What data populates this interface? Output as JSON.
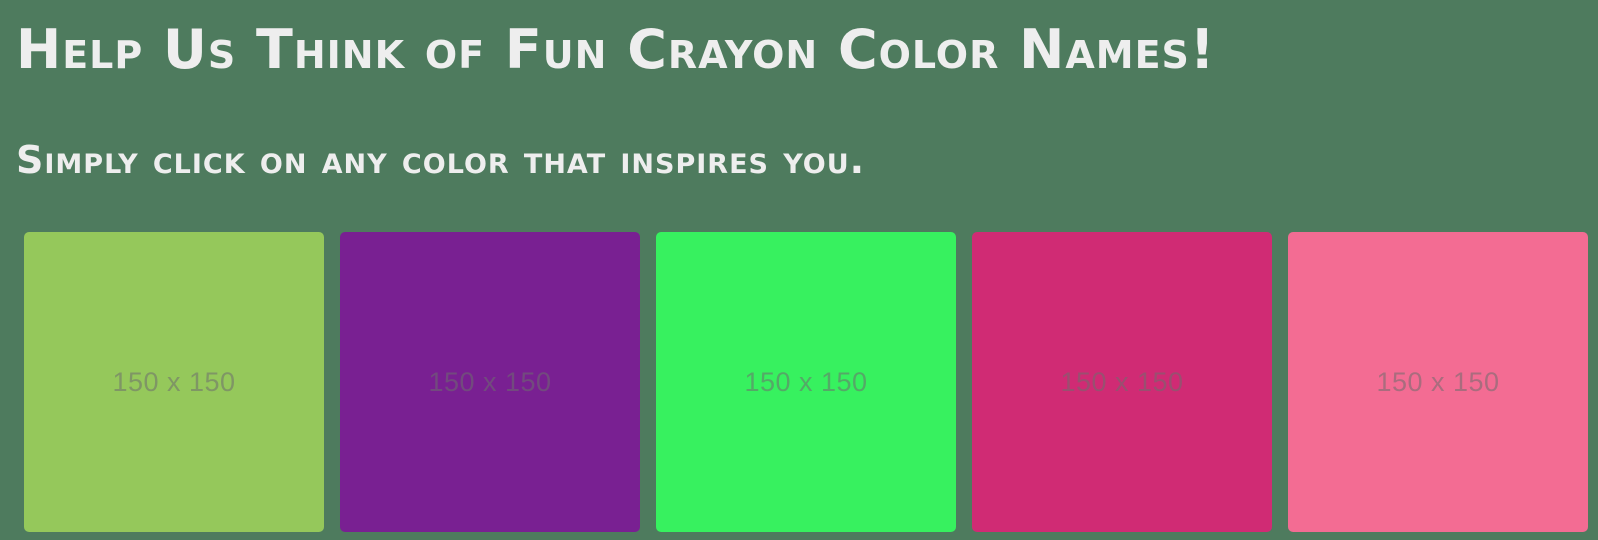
{
  "header": {
    "title": "Help Us Think of Fun Crayon Color Names!",
    "subtitle": "Simply click on any color that inspires you."
  },
  "swatches": [
    {
      "label": "150 x 150",
      "color": "#95c85b"
    },
    {
      "label": "150 x 150",
      "color": "#792092"
    },
    {
      "label": "150 x 150",
      "color": "#37f15f"
    },
    {
      "label": "150 x 150",
      "color": "#d02b74"
    },
    {
      "label": "150 x 150",
      "color": "#f36c93"
    }
  ],
  "colors": {
    "page_background": "#4e7b5e",
    "text": "#eeeeee"
  }
}
